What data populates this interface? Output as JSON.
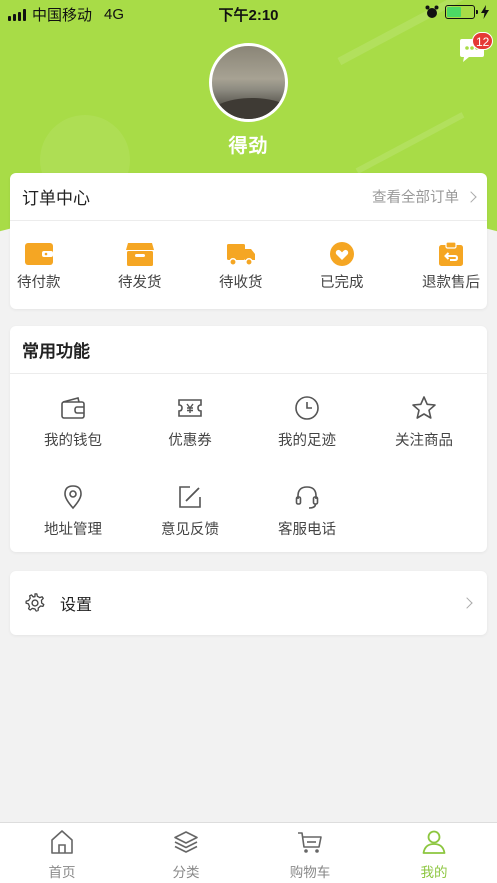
{
  "status_bar": {
    "carrier": "中国移动",
    "network": "4G",
    "time": "下午2:10"
  },
  "header": {
    "message_badge_count": "12",
    "username": "得劲"
  },
  "orders": {
    "title": "订单中心",
    "view_all": "查看全部订单",
    "items": [
      {
        "label": "待付款",
        "icon": "wallet-icon"
      },
      {
        "label": "待发货",
        "icon": "box-icon"
      },
      {
        "label": "待收货",
        "icon": "truck-icon"
      },
      {
        "label": "已完成",
        "icon": "heart-check-icon"
      },
      {
        "label": "退款售后",
        "icon": "refund-icon"
      }
    ]
  },
  "functions": {
    "title": "常用功能",
    "items": [
      {
        "label": "我的钱包",
        "icon": "wallet-icon"
      },
      {
        "label": "优惠券",
        "icon": "coupon-icon"
      },
      {
        "label": "我的足迹",
        "icon": "clock-icon"
      },
      {
        "label": "关注商品",
        "icon": "star-icon"
      },
      {
        "label": "地址管理",
        "icon": "location-pin-icon"
      },
      {
        "label": "意见反馈",
        "icon": "edit-icon"
      },
      {
        "label": "客服电话",
        "icon": "headset-icon"
      }
    ]
  },
  "settings": {
    "label": "设置",
    "icon": "gear-icon"
  },
  "tabbar": {
    "items": [
      {
        "label": "首页",
        "icon": "home-icon"
      },
      {
        "label": "分类",
        "icon": "layers-icon"
      },
      {
        "label": "购物车",
        "icon": "cart-icon"
      },
      {
        "label": "我的",
        "icon": "user-icon",
        "active": true
      }
    ]
  },
  "colors": {
    "brand_green": "#a8dc47",
    "active_tab": "#8cc63f",
    "order_icon_orange": "#f5a623",
    "badge_red": "#e53935"
  }
}
